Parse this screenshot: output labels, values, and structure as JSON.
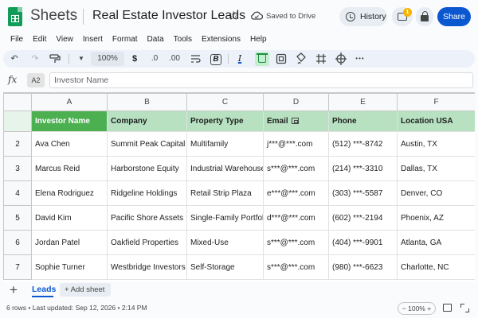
{
  "header": {
    "app_name": "Sheets",
    "doc_title": "Real Estate Investor Leads",
    "saved_status": "Saved to Drive",
    "history_label": "History",
    "comment_count": "1",
    "share_label": "Share"
  },
  "menu": [
    "File",
    "Edit",
    "View",
    "Insert",
    "Format",
    "Data",
    "Tools",
    "Extensions",
    "Help"
  ],
  "toolbar": {
    "zoom": "100%",
    "currency": "$",
    "decrease_decimal": ".0",
    "increase_decimal": ".00",
    "more": "•••"
  },
  "formula_bar": {
    "fx": "fx",
    "cell_ref": "A2",
    "value": "Investor Name"
  },
  "grid": {
    "columns": [
      "A",
      "B",
      "C",
      "D",
      "E",
      "F"
    ],
    "header_row_num": "",
    "headers": [
      "Investor Name",
      "Company",
      "Property Type",
      "Email",
      "Phone",
      "Location USA"
    ],
    "rows": [
      {
        "num": "2",
        "name": "Ava Chen",
        "company": "Summit Peak Capital",
        "type": "Multifamily",
        "email": "j***@***.com",
        "phone": "(512) ***-8742",
        "location": "Austin, TX"
      },
      {
        "num": "3",
        "name": "Marcus Reid",
        "company": "Harborstone Equity",
        "type": "Industrial Warehouse",
        "email": "s***@***.com",
        "phone": "(214) ***-3310",
        "location": "Dallas, TX"
      },
      {
        "num": "4",
        "name": "Elena Rodriguez",
        "company": "Ridgeline Holdings",
        "type": "Retail Strip Plaza",
        "email": "e***@***.com",
        "phone": "(303) ***-5587",
        "location": "Denver, CO"
      },
      {
        "num": "5",
        "name": "David Kim",
        "company": "Pacific Shore Assets",
        "type": "Single-Family Portfolio",
        "email": "d***@***.com",
        "phone": "(602) ***-2194",
        "location": "Phoenix, AZ"
      },
      {
        "num": "6",
        "name": "Jordan Patel",
        "company": "Oakfield Properties",
        "type": "Mixed-Use",
        "email": "s***@***.com",
        "phone": "(404) ***-9901",
        "location": "Atlanta, GA"
      },
      {
        "num": "7",
        "name": "Sophie Turner",
        "company": "Westbridge Investors",
        "type": "Self-Storage",
        "email": "s***@***.com",
        "phone": "(980) ***-6623",
        "location": "Charlotte, NC"
      }
    ]
  },
  "sheets": {
    "active_tab": "Leads",
    "add_sheet": "+ Add sheet"
  },
  "status": {
    "summary": "6 rows • Last updated: Sep 12, 2026 • 2:14 PM",
    "zoom": "− 100% +"
  },
  "colors": {
    "accent": "#0b57d0",
    "header_fill": "#b7e1c1",
    "selected_cell": "#4caf50",
    "brand": "#0f9d58"
  }
}
